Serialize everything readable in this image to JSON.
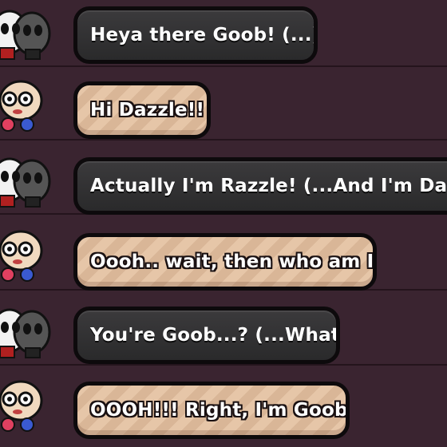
{
  "chat": {
    "messages": [
      {
        "speaker": "razzle-dazzle",
        "style": "dark",
        "text": "Heya there Goob! (...)"
      },
      {
        "speaker": "goob",
        "style": "tan",
        "text": "Hi Dazzle!!"
      },
      {
        "speaker": "razzle-dazzle",
        "style": "dark",
        "text": "Actually I'm Razzle! (...And I'm Dazz"
      },
      {
        "speaker": "goob",
        "style": "tan",
        "text": "Oooh.. wait, then who am I?"
      },
      {
        "speaker": "razzle-dazzle",
        "style": "dark",
        "text": "You're Goob...? (...What)"
      },
      {
        "speaker": "goob",
        "style": "tan",
        "text": "OOOH!!! Right, I'm Goob!!"
      }
    ]
  },
  "colors": {
    "background": "#3a2430",
    "dark_bubble": "#2f2f30",
    "tan_bubble": "#e6c6a8",
    "outline": "#0d0a0c"
  },
  "icons": {
    "razzle_dazzle": "razzle-dazzle-avatar-icon",
    "goob": "goob-avatar-icon"
  }
}
